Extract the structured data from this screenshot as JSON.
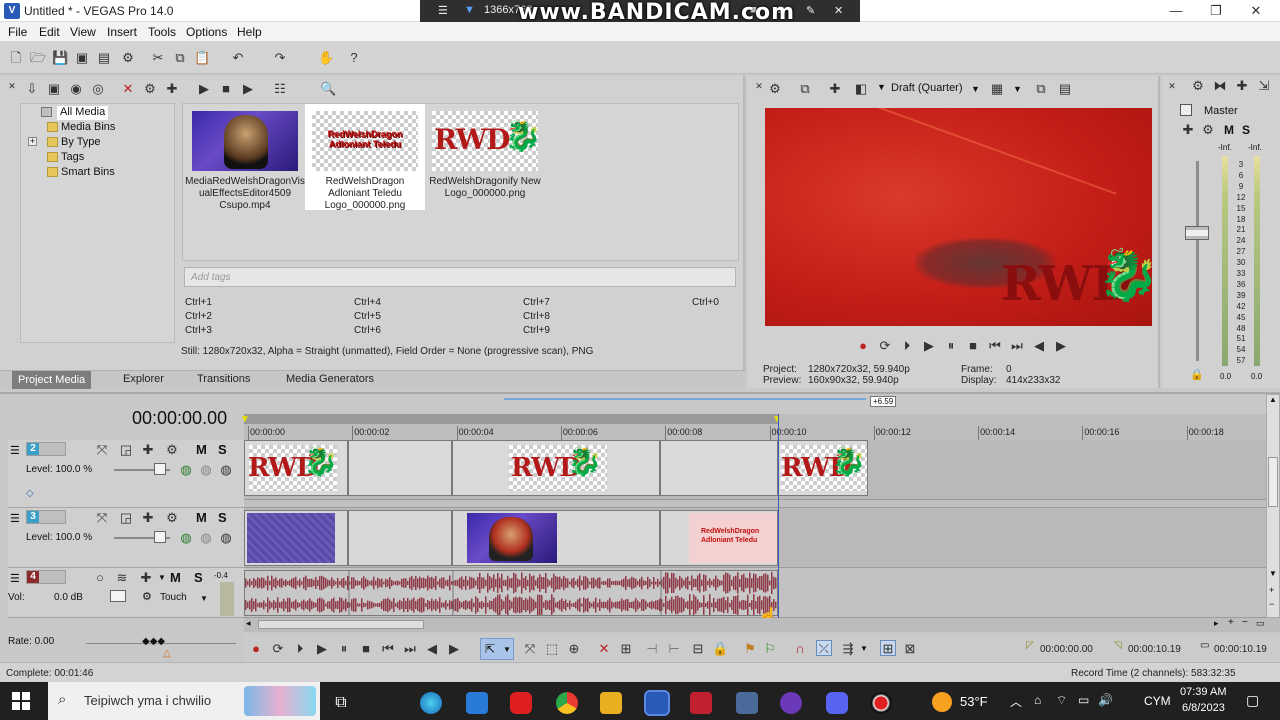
{
  "window": {
    "title": "Untitled * - VEGAS Pro 14.0",
    "recorder_resolution": "1366x768",
    "watermark": "www.BANDICAM.com"
  },
  "menu": [
    "File",
    "Edit",
    "View",
    "Insert",
    "Tools",
    "Options",
    "Help"
  ],
  "project_media": {
    "tree": [
      "All Media",
      "Media Bins",
      "By Type",
      "Tags",
      "Smart Bins"
    ],
    "selected_tree": "All Media",
    "items": [
      {
        "name": "MediaRedWelshDragonVisualEffectsEditor4509Csupo.mp4",
        "caption_lines": [
          "MediaRedWelshDragonVis",
          "ualEffectsEditor4509",
          "Csupo.mp4"
        ]
      },
      {
        "name": "RedWelshDragon Adloniant Teledu Logo_000000.png",
        "caption_lines": [
          "RedWelshDragon",
          "Adloniant Teledu",
          "Logo_000000.png"
        ],
        "thumb_text": [
          "RedWelshDragon",
          "Adloniant Teledu"
        ]
      },
      {
        "name": "RedWelshDragonify New Logo_000000.png",
        "caption_lines": [
          "RedWelshDragonify New",
          "Logo_000000.png"
        ],
        "thumb_text": [
          "RWD"
        ]
      }
    ],
    "tags_placeholder": "Add tags",
    "shortcuts": [
      [
        "Ctrl+1",
        "Ctrl+4",
        "Ctrl+7",
        "Ctrl+0"
      ],
      [
        "Ctrl+2",
        "Ctrl+5",
        "Ctrl+8",
        ""
      ],
      [
        "Ctrl+3",
        "Ctrl+6",
        "Ctrl+9",
        ""
      ]
    ],
    "media_info": "Still: 1280x720x32, Alpha = Straight (unmatted), Field Order = None (progressive scan), PNG",
    "tabs": [
      "Project Media",
      "Explorer",
      "Transitions",
      "Media Generators"
    ],
    "active_tab": "Project Media"
  },
  "preview": {
    "quality": "Draft (Quarter)",
    "frame_text": "RWD",
    "project_label": "Project:",
    "project_value": "1280x720x32, 59.940p",
    "preview_label": "Preview:",
    "preview_value": "160x90x32, 59.940p",
    "frame_label": "Frame:",
    "frame_value": "0",
    "display_label": "Display:",
    "display_value": "414x233x32"
  },
  "master": {
    "label": "Master",
    "inf_left": "-Inf.",
    "inf_right": "-Inf.",
    "scale": [
      "3",
      "6",
      "9",
      "12",
      "15",
      "18",
      "21",
      "24",
      "27",
      "30",
      "33",
      "36",
      "39",
      "42",
      "45",
      "48",
      "51",
      "54",
      "57"
    ],
    "value_left": "0.0",
    "value_right": "0.0"
  },
  "timeline": {
    "timecode": "00:00:00.00",
    "marker": "+6.59",
    "ruler": [
      "00:00:00",
      "00:00:02",
      "00:00:04",
      "00:00:06",
      "00:00:08",
      "00:00:10",
      "00:00:12",
      "00:00:14",
      "00:00:16",
      "00:00:18"
    ],
    "tracks": [
      {
        "number": "2",
        "level_label": "Level: 100.0 %",
        "mute": "M",
        "solo": "S"
      },
      {
        "number": "3",
        "level_label": "Level: 100.0 %",
        "mute": "M",
        "solo": "S"
      },
      {
        "number": "4",
        "vol_label": "Vol:",
        "vol_value": "0.0 dB",
        "mode": "Touch",
        "mute": "M",
        "solo": "S",
        "meter_value": "-0.4"
      }
    ],
    "clip_text": "RWD",
    "rate": "Rate: 0.00",
    "cursor_time": "00:00:00.00",
    "end_time": "00:00:10.19",
    "length_time": "00:00:10.19",
    "record_time": "Record Time (2 channels): 583:32:35"
  },
  "status": {
    "complete": "Complete: 00:01:46"
  },
  "taskbar": {
    "search_placeholder": "Teipiwch yma i chwilio",
    "weather": "53°F",
    "language": "CYM",
    "time": "07:39 AM",
    "date": "6/8/2023"
  },
  "colors": {
    "accent_red": "#c41e18",
    "track_video_blue": "#3aa0c8",
    "track_audio_red": "#8b2a2a",
    "waveform": "#8e3a48"
  }
}
